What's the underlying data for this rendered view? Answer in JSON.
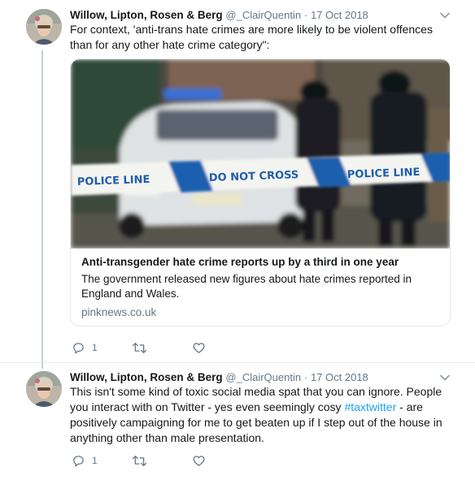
{
  "tweets": [
    {
      "author": "Willow, Lipton, Rosen & Berg",
      "handle": "@_ClairQuentin",
      "separator": "·",
      "date": "17 Oct 2018",
      "text": "For context, 'anti-trans hate crimes are more likely to be violent offences than for any other hate crime category\":",
      "card": {
        "image_sign_left": "POLICE LINE",
        "image_sign_middle": "DO NOT CROSS",
        "image_sign_right": "POLICE LINE",
        "title": "Anti-transgender hate crime reports up by a third in one year",
        "description": "The government released new figures about hate crimes reported in England and Wales.",
        "domain": "pinknews.co.uk"
      },
      "reply_count": "1",
      "icons": {
        "reply": "reply-icon",
        "retweet": "retweet-icon",
        "like": "heart-icon",
        "menu": "chevron-down-icon"
      }
    },
    {
      "author": "Willow, Lipton, Rosen & Berg",
      "handle": "@_ClairQuentin",
      "separator": "·",
      "date": "17 Oct 2018",
      "text_part1": "This isn't some kind of toxic social media spat that you can ignore. People you interact with on Twitter - yes even seemingly cosy ",
      "hashtag": "#taxtwitter",
      "text_part2": " - are positively campaigning for me to get beaten up if I step out of the house in anything other than male presentation.",
      "reply_count": "1",
      "icons": {
        "reply": "reply-icon",
        "retweet": "retweet-icon",
        "like": "heart-icon",
        "menu": "chevron-down-icon"
      }
    }
  ],
  "colors": {
    "link": "#1da1f2",
    "secondary_text": "#657786",
    "thread_line": "#c4cfd6",
    "police_tape_blue": "#1f5fae"
  }
}
